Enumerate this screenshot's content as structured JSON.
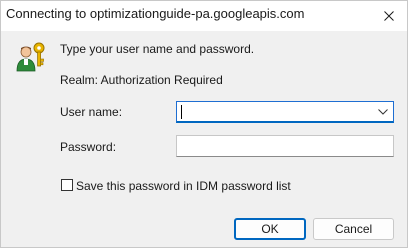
{
  "window": {
    "title": "Connecting to optimizationguide-pa.googleapis.com",
    "close_icon": "close-icon"
  },
  "dialog": {
    "icon": "user-key-icon",
    "prompt": "Type your user name and password.",
    "realm": "Realm: Authorization Required"
  },
  "form": {
    "username_label": "User name:",
    "username_value": "",
    "password_label": "Password:",
    "password_value": "",
    "save_checkbox_label": "Save this password in IDM password list",
    "save_checked": false
  },
  "buttons": {
    "ok_label": "OK",
    "cancel_label": "Cancel"
  },
  "colors": {
    "accent": "#0067c0",
    "dialog_bg": "#f0f0f0",
    "titlebar_bg": "#ffffff"
  }
}
